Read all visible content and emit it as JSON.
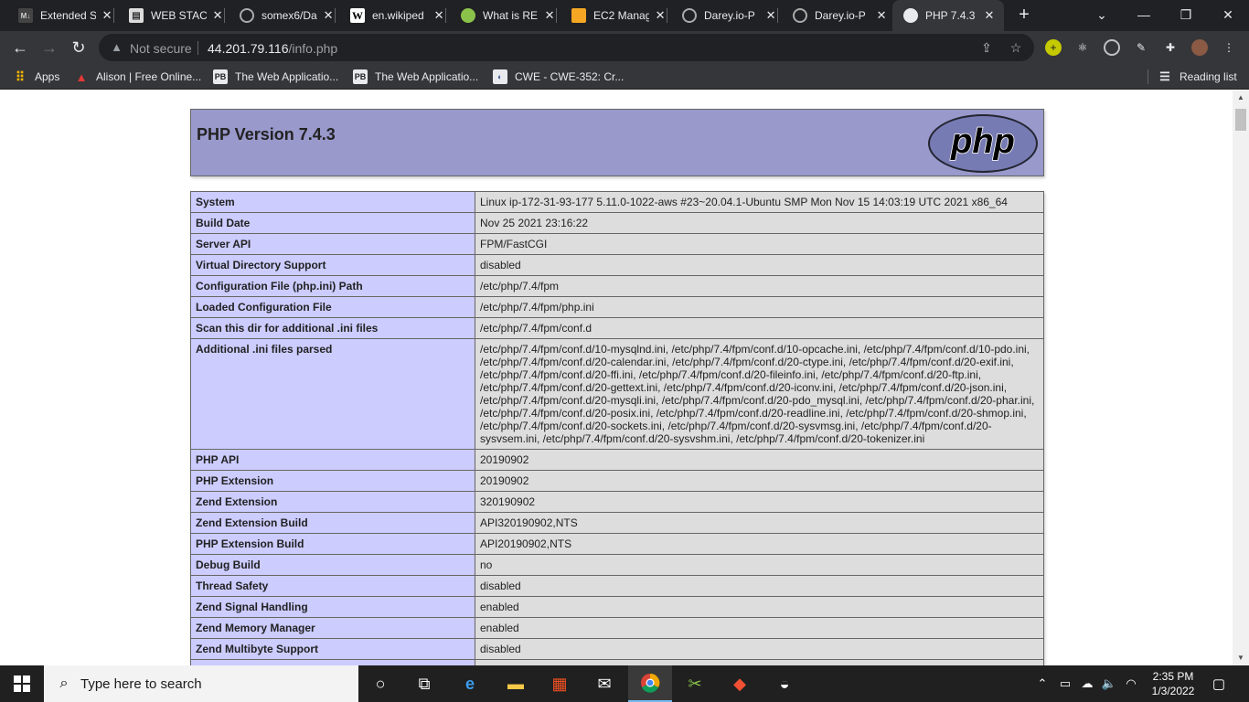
{
  "browser": {
    "tabs": [
      {
        "title": "Extended S",
        "icon": "md-icon"
      },
      {
        "title": "WEB STACK",
        "icon": "doc-icon"
      },
      {
        "title": "somex6/Da",
        "icon": "github-icon"
      },
      {
        "title": "en.wikiped",
        "icon": "wikipedia-icon"
      },
      {
        "title": "What is RE",
        "icon": "globe-green-icon"
      },
      {
        "title": "EC2 Manag",
        "icon": "aws-icon"
      },
      {
        "title": "Darey.io-P",
        "icon": "github-icon"
      },
      {
        "title": "Darey.io-P",
        "icon": "github-icon"
      },
      {
        "title": "PHP 7.4.3",
        "icon": "globe-icon"
      }
    ],
    "tab_close_glyph": "✕",
    "new_tab_glyph": "+",
    "omnibox": {
      "security_label": "Not secure",
      "url_host": "44.201.79.116",
      "url_path": "/info.php"
    },
    "bookmarks": [
      {
        "label": "Apps",
        "icon": "apps-grid-icon"
      },
      {
        "label": "Alison | Free Online...",
        "icon": "alison-icon"
      },
      {
        "label": "The Web Applicatio...",
        "icon": "pb-icon"
      },
      {
        "label": "The Web Applicatio...",
        "icon": "pb-icon"
      },
      {
        "label": "CWE - CWE-352: Cr...",
        "icon": "cwe-icon"
      }
    ],
    "reading_list_label": "Reading list"
  },
  "php": {
    "version_title": "PHP Version 7.4.3",
    "logo_text": "php",
    "rows": [
      {
        "key": "System",
        "value": "Linux ip-172-31-93-177 5.11.0-1022-aws #23~20.04.1-Ubuntu SMP Mon Nov 15 14:03:19 UTC 2021 x86_64"
      },
      {
        "key": "Build Date",
        "value": "Nov 25 2021 23:16:22"
      },
      {
        "key": "Server API",
        "value": "FPM/FastCGI"
      },
      {
        "key": "Virtual Directory Support",
        "value": "disabled"
      },
      {
        "key": "Configuration File (php.ini) Path",
        "value": "/etc/php/7.4/fpm"
      },
      {
        "key": "Loaded Configuration File",
        "value": "/etc/php/7.4/fpm/php.ini"
      },
      {
        "key": "Scan this dir for additional .ini files",
        "value": "/etc/php/7.4/fpm/conf.d"
      },
      {
        "key": "Additional .ini files parsed",
        "value": "/etc/php/7.4/fpm/conf.d/10-mysqlnd.ini, /etc/php/7.4/fpm/conf.d/10-opcache.ini, /etc/php/7.4/fpm/conf.d/10-pdo.ini, /etc/php/7.4/fpm/conf.d/20-calendar.ini, /etc/php/7.4/fpm/conf.d/20-ctype.ini, /etc/php/7.4/fpm/conf.d/20-exif.ini, /etc/php/7.4/fpm/conf.d/20-ffi.ini, /etc/php/7.4/fpm/conf.d/20-fileinfo.ini, /etc/php/7.4/fpm/conf.d/20-ftp.ini, /etc/php/7.4/fpm/conf.d/20-gettext.ini, /etc/php/7.4/fpm/conf.d/20-iconv.ini, /etc/php/7.4/fpm/conf.d/20-json.ini, /etc/php/7.4/fpm/conf.d/20-mysqli.ini, /etc/php/7.4/fpm/conf.d/20-pdo_mysql.ini, /etc/php/7.4/fpm/conf.d/20-phar.ini, /etc/php/7.4/fpm/conf.d/20-posix.ini, /etc/php/7.4/fpm/conf.d/20-readline.ini, /etc/php/7.4/fpm/conf.d/20-shmop.ini, /etc/php/7.4/fpm/conf.d/20-sockets.ini, /etc/php/7.4/fpm/conf.d/20-sysvmsg.ini, /etc/php/7.4/fpm/conf.d/20-sysvsem.ini, /etc/php/7.4/fpm/conf.d/20-sysvshm.ini, /etc/php/7.4/fpm/conf.d/20-tokenizer.ini"
      },
      {
        "key": "PHP API",
        "value": "20190902"
      },
      {
        "key": "PHP Extension",
        "value": "20190902"
      },
      {
        "key": "Zend Extension",
        "value": "320190902"
      },
      {
        "key": "Zend Extension Build",
        "value": "API320190902,NTS"
      },
      {
        "key": "PHP Extension Build",
        "value": "API20190902,NTS"
      },
      {
        "key": "Debug Build",
        "value": "no"
      },
      {
        "key": "Thread Safety",
        "value": "disabled"
      },
      {
        "key": "Zend Signal Handling",
        "value": "enabled"
      },
      {
        "key": "Zend Memory Manager",
        "value": "enabled"
      },
      {
        "key": "Zend Multibyte Support",
        "value": "disabled"
      },
      {
        "key": "",
        "value": ""
      }
    ]
  },
  "taskbar": {
    "search_placeholder": "Type here to search",
    "time": "2:35 PM",
    "date": "1/3/2022"
  },
  "colors": {
    "php_header": "#9999cc",
    "key_cell": "#ccccff",
    "value_cell": "#dddddd",
    "browser_dark": "#202124",
    "toolbar": "#35363a"
  }
}
